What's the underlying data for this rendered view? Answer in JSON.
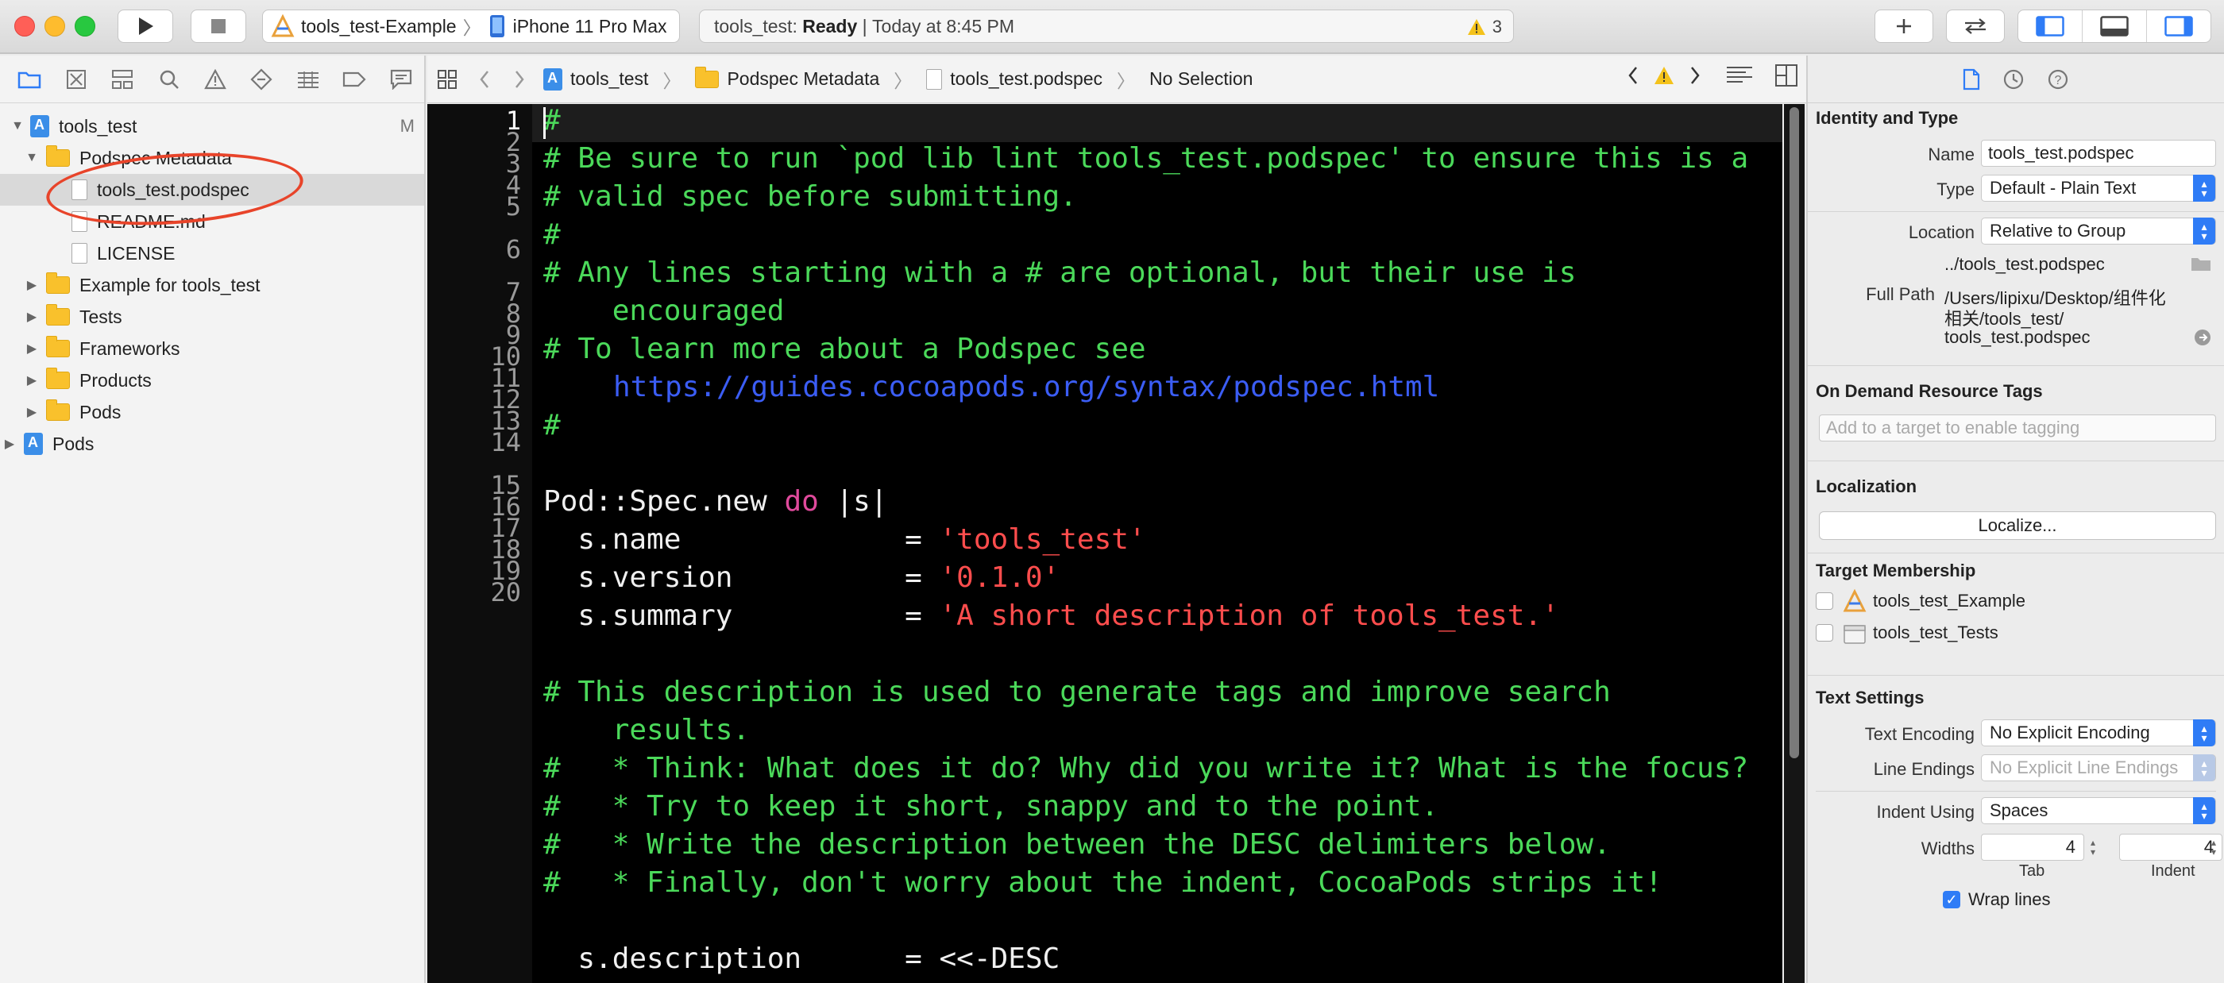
{
  "toolbar": {
    "scheme_name": "tools_test-Example",
    "device": "iPhone 11 Pro Max",
    "status_project": "tools_test:",
    "status_state": "Ready",
    "status_time": "Today at 8:45 PM",
    "warning_count": "3"
  },
  "navigator": {
    "items": [
      {
        "label": "tools_test",
        "badge": "M"
      },
      {
        "label": "Podspec Metadata"
      },
      {
        "label": "tools_test.podspec"
      },
      {
        "label": "README.md"
      },
      {
        "label": "LICENSE"
      },
      {
        "label": "Example for tools_test"
      },
      {
        "label": "Tests"
      },
      {
        "label": "Frameworks"
      },
      {
        "label": "Products"
      },
      {
        "label": "Pods"
      },
      {
        "label": "Pods"
      }
    ]
  },
  "jumpbar": {
    "crumbs": [
      "tools_test",
      "Podspec Metadata",
      "tools_test.podspec",
      "No Selection"
    ]
  },
  "editor": {
    "line_numbers": [
      "1",
      "2",
      "3",
      "4",
      "5",
      "6",
      "7",
      "8",
      "9",
      "10",
      "11",
      "12",
      "13",
      "14",
      "15",
      "16",
      "17",
      "18",
      "19",
      "20"
    ],
    "lines": {
      "l1": "#",
      "l2": "# Be sure to run `pod lib lint tools_test.podspec' to ensure this is a",
      "l3": "# valid spec before submitting.",
      "l4": "#",
      "l5a": "# Any lines starting with a # are optional, but their use is",
      "l5b": "    encouraged",
      "l6a": "# To learn more about a Podspec see",
      "l6b": "https://guides.cocoapods.org/syntax/podspec.html",
      "l7": "#",
      "l9a": "Pod::Spec.new ",
      "l9kw": "do",
      "l9b": " |s|",
      "l10a": "  s.name             = ",
      "l10s": "'tools_test'",
      "l11a": "  s.version          = ",
      "l11s": "'0.1.0'",
      "l12a": "  s.summary          = ",
      "l12s": "'A short description of tools_test.'",
      "l14a": "# This description is used to generate tags and improve search",
      "l14b": "    results.",
      "l15": "#   * Think: What does it do? Why did you write it? What is the focus?",
      "l16": "#   * Try to keep it short, snappy and to the point.",
      "l17": "#   * Write the description between the DESC delimiters below.",
      "l18": "#   * Finally, don't worry about the indent, CocoaPods strips it!",
      "l20": "  s.description      = <<-DESC"
    }
  },
  "inspector": {
    "identity_title": "Identity and Type",
    "name_label": "Name",
    "name_value": "tools_test.podspec",
    "type_label": "Type",
    "type_value": "Default - Plain Text",
    "location_label": "Location",
    "location_value": "Relative to Group",
    "relative_path": "../tools_test.podspec",
    "fullpath_label": "Full Path",
    "fullpath_l1": "/Users/lipixu/Desktop/组件化",
    "fullpath_l2": "相关/tools_test/",
    "fullpath_l3": "tools_test.podspec",
    "odr_title": "On Demand Resource Tags",
    "odr_placeholder": "Add to a target to enable tagging",
    "localization_title": "Localization",
    "localize_button": "Localize...",
    "target_title": "Target Membership",
    "targets": [
      "tools_test_Example",
      "tools_test_Tests"
    ],
    "text_settings_title": "Text Settings",
    "encoding_label": "Text Encoding",
    "encoding_value": "No Explicit Encoding",
    "line_endings_label": "Line Endings",
    "line_endings_value": "No Explicit Line Endings",
    "indent_using_label": "Indent Using",
    "indent_using_value": "Spaces",
    "widths_label": "Widths",
    "tab_value": "4",
    "indent_value": "4",
    "tab_label": "Tab",
    "indent_label": "Indent",
    "wrap_label": "Wrap lines"
  }
}
